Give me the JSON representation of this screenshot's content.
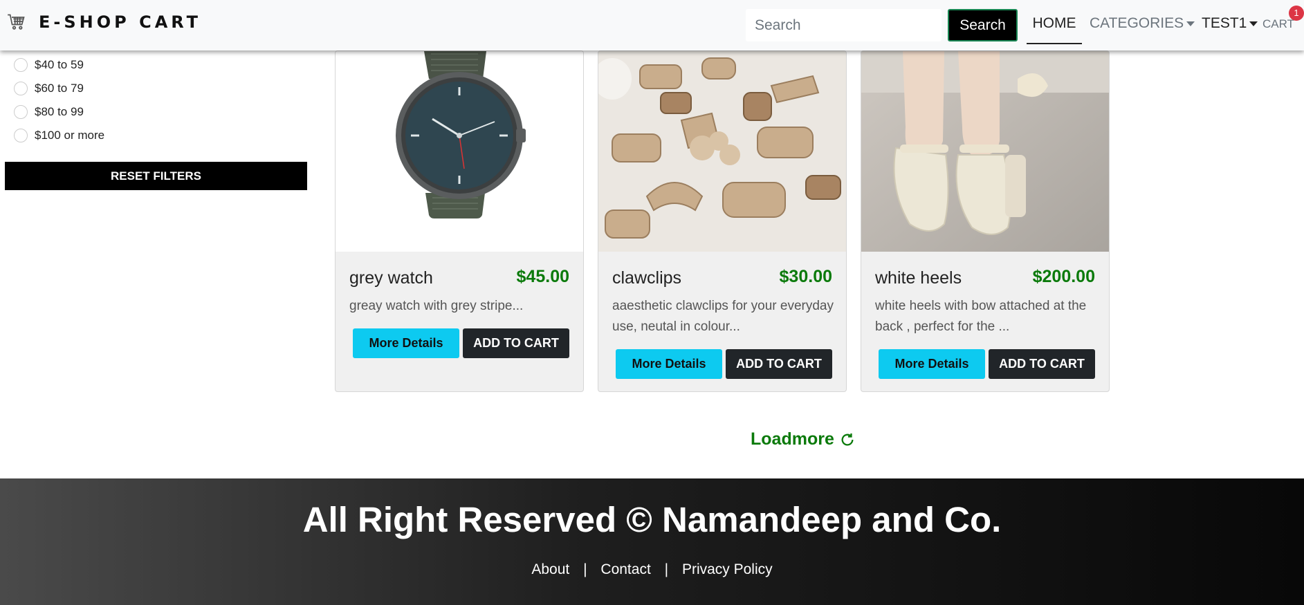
{
  "navbar": {
    "brand": "E-SHOP CART",
    "brand_icon": "shopping-cart-icon",
    "search_placeholder": "Search",
    "search_button": "Search",
    "home": "HOME",
    "categories": "CATEGORIES",
    "user": "TEST1",
    "cart": "CART",
    "cart_count": "1"
  },
  "filters": {
    "price_options": [
      "$40 to 59",
      "$60 to 79",
      "$80 to 99",
      "$100 or more"
    ],
    "reset_label": "RESET FILTERS"
  },
  "products": [
    {
      "name": "grey watch",
      "price": "$45.00",
      "description": "greay watch with grey stripe...",
      "details_label": "More Details",
      "cart_label": "ADD TO CART"
    },
    {
      "name": "clawclips",
      "price": "$30.00",
      "description": "aaesthetic clawclips for your everyday use, neutal in colour...",
      "details_label": "More Details",
      "cart_label": "ADD TO CART"
    },
    {
      "name": "white heels",
      "price": "$200.00",
      "description": "white heels with bow attached at the back , perfect for the ...",
      "details_label": "More Details",
      "cart_label": "ADD TO CART"
    }
  ],
  "loadmore": "Loadmore",
  "footer": {
    "title": "All Right Reserved © Namandeep and Co.",
    "links": [
      "About",
      "Contact",
      "Privacy Policy"
    ],
    "separator": "|"
  },
  "colors": {
    "price_green": "#0b7a0b",
    "details_cyan": "#0dcaf0",
    "cart_dark": "#212529",
    "badge_red": "#dc3545"
  }
}
